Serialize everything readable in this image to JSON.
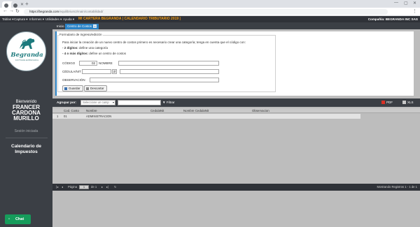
{
  "browser": {
    "url_host": "https://begranda.com",
    "url_path": "/equilibrium2/main/contabilidad/"
  },
  "app": {
    "menu": [
      "Tablas ▾",
      "Captura ▾",
      "Informes ▾",
      "Utilidades ▾",
      "Ayuda ▾"
    ],
    "title": "MI CARTERA BEGRANDA | CALENDARIO TRIBUTARIO 2019 |",
    "company": "Compañía: BEGRANDA INC SAS",
    "colors": {
      "header_bg": "#2f3238",
      "sidebar_bg": "#3b3f45",
      "accent": "#2a83c7",
      "title": "#f39c12",
      "chat": "#169c5b"
    }
  },
  "sidebar": {
    "logo_text": "Begranda",
    "logo_subtext": "SOFTWARE EMPRESARIAL",
    "welcome": "Bienvenido",
    "user_name": [
      "FRANCER",
      "CARDONA",
      "MURILLO"
    ],
    "session": "Sesión iniciada",
    "calendar": [
      "Calendario de",
      "Impuestos"
    ]
  },
  "tabs": [
    {
      "label": "Inicio"
    },
    {
      "label": "Centro de Costos",
      "close": "x"
    }
  ],
  "form": {
    "legend": "Formulario de ingreso/edición",
    "info_line1": "Para iniciar la creación de un nuevo centro de costos primero es necesario crear una categoría; tenga en cuenta que el código con:",
    "info_line2_bold": "- 2 dígitos:",
    "info_line2": " define una categoría",
    "info_line3_bold": "- 4 o más dígitos:",
    "info_line3": " define un centro de costos",
    "codigo_label": "CÓDIGO",
    "codigo_value": "02",
    "nombre_label": "NOMBRE",
    "nombre_value": "",
    "cedula_label": "CÉDULA/NIT",
    "cedula_value": "",
    "lookup_symbol": "⇵",
    "observacion_label": "OBSERVACIÓN",
    "observacion_value": "",
    "save_button": "Guardar",
    "discard_button": "Descartar"
  },
  "grid": {
    "group_label": "Agrupar por:",
    "group_placeholder": "Seleccione un camp",
    "filter_value": "",
    "filter_label": "Filtrar",
    "pdf_label": "PDF",
    "xls_label": "XLS",
    "columns": [
      "Cod. Costo",
      "Nombre",
      "CedulaNit",
      "Nombre CedulaNit",
      "Observacion"
    ],
    "rows": [
      {
        "num": "1",
        "cod": "01",
        "nombre": "ADMINISTRACION",
        "cedula": "",
        "nombre_cedula": "",
        "observacion": ""
      }
    ],
    "footer_page_label": "Página",
    "footer_page_value": "1",
    "footer_of": "de 1",
    "footer_status": "Mostrando Registros 1 - 1 de 1"
  },
  "chat": {
    "label": "Chat",
    "icon": "chat-bubble-icon"
  }
}
